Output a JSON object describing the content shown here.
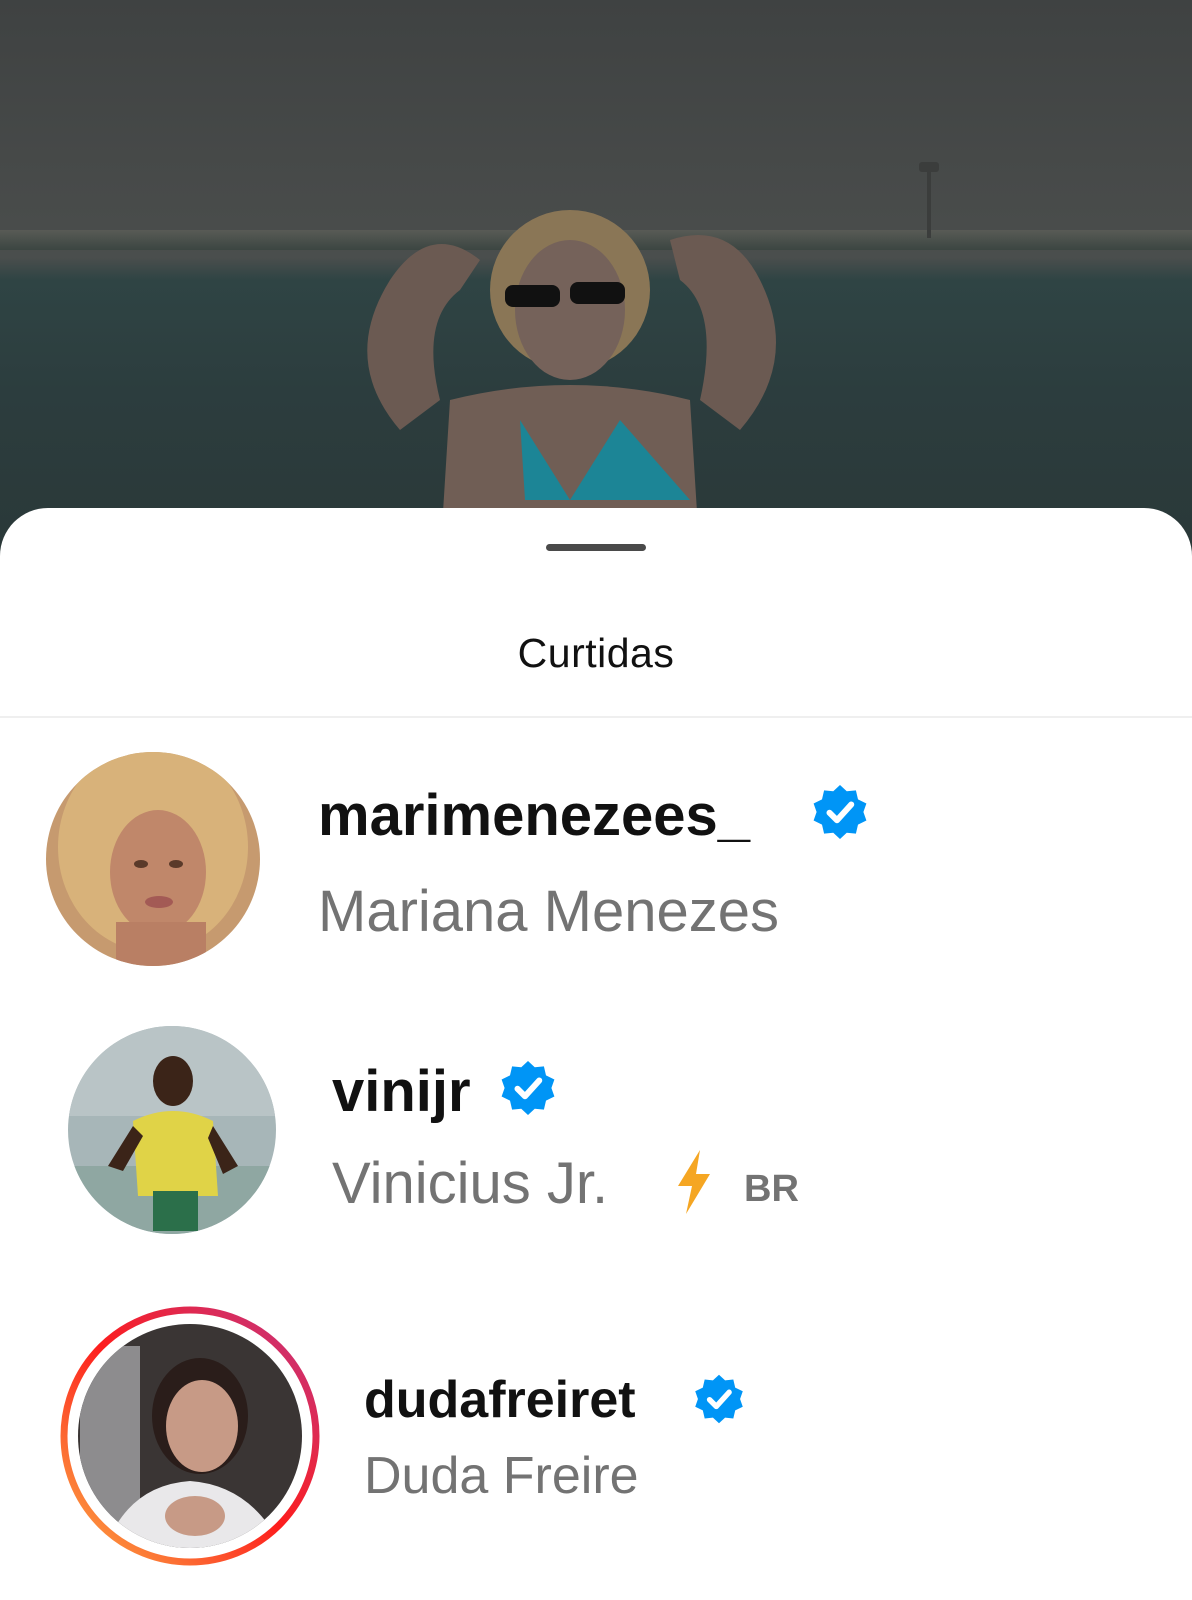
{
  "sheet": {
    "title": "Curtidas"
  },
  "likes": [
    {
      "username": "marimenezees_",
      "full_name": "Mariana Menezes",
      "verified": true
    },
    {
      "username": "vinijr",
      "full_name": "Vinicius Jr.",
      "verified": true,
      "extra_icon": "lightning-icon",
      "extra_tag": "BR"
    },
    {
      "username": "dudafreiret",
      "full_name": "Duda Freire",
      "verified": true,
      "story_ring": true
    }
  ],
  "colors": {
    "verified": "#0095f6",
    "name_secondary": "#737373",
    "bolt": "#f5a623"
  }
}
